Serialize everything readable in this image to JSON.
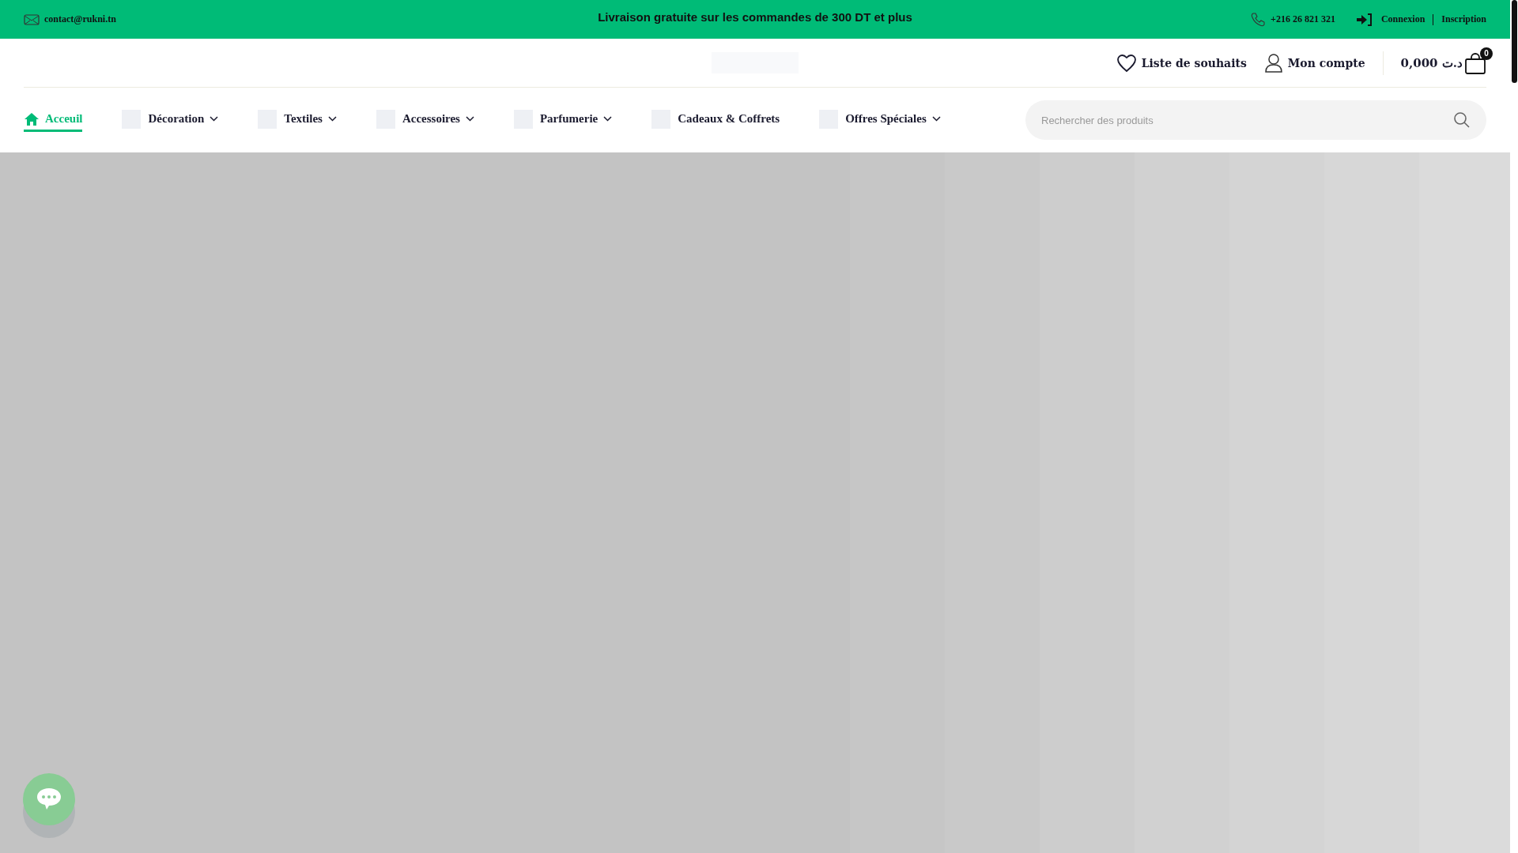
{
  "top_bar": {
    "email": "contact@rukni.tn",
    "promo": "Livraison gratuite sur les commandes de 300 DT et plus",
    "phone": "+216 26 821 321",
    "login": "Connexion",
    "register": "Inscription"
  },
  "header": {
    "wishlist": "Liste de souhaits",
    "account": "Mon compte",
    "cart_total": "0,000 د.ت",
    "cart_count": "0"
  },
  "nav": [
    {
      "label": "Acceuil",
      "selected": true,
      "dropdown": false,
      "kind": "home"
    },
    {
      "label": "Décoration",
      "selected": false,
      "dropdown": true,
      "kind": "category"
    },
    {
      "label": "Textiles",
      "selected": false,
      "dropdown": true,
      "kind": "category"
    },
    {
      "label": "Accessoires",
      "selected": false,
      "dropdown": true,
      "kind": "category"
    },
    {
      "label": "Parfumerie",
      "selected": false,
      "dropdown": true,
      "kind": "category"
    },
    {
      "label": "Cadeaux & Coffrets",
      "selected": false,
      "dropdown": false,
      "kind": "category"
    },
    {
      "label": "Offres Spéciales",
      "selected": false,
      "dropdown": true,
      "kind": "category"
    }
  ],
  "search": {
    "placeholder": "Rechercher des produits"
  }
}
